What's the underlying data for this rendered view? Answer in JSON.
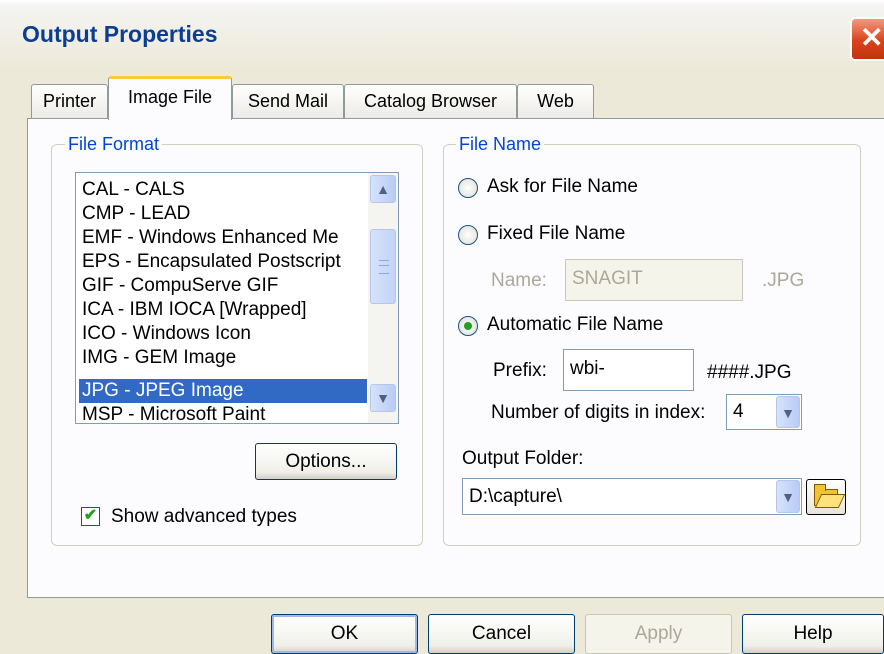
{
  "window": {
    "title": "Output Properties",
    "close_glyph": "✕"
  },
  "tabs": [
    {
      "label": "Printer",
      "active": false
    },
    {
      "label": "Image File",
      "active": true
    },
    {
      "label": "Send Mail",
      "active": false
    },
    {
      "label": "Catalog Browser",
      "active": false
    },
    {
      "label": "Web",
      "active": false
    }
  ],
  "file_format": {
    "legend": "File Format",
    "items": [
      "CAL - CALS",
      "CMP - LEAD",
      "EMF - Windows Enhanced Me",
      "EPS - Encapsulated Postscript",
      "GIF - CompuServe GIF",
      "ICA - IBM IOCA [Wrapped]",
      "ICO - Windows Icon",
      "IMG - GEM Image",
      "JPG - JPEG Image",
      "MSP - Microsoft Paint"
    ],
    "selected": "JPG - JPEG Image",
    "options_button": "Options...",
    "show_advanced_label": "Show advanced types",
    "show_advanced_checked": true,
    "checkmark": "✔",
    "scroll_up_glyph": "▲",
    "scroll_down_glyph": "▼"
  },
  "file_name": {
    "legend": "File Name",
    "ask_label": "Ask for File Name",
    "fixed_label": "Fixed File Name",
    "name_label": "Name:",
    "name_value": "SNAGIT",
    "name_ext": ".JPG",
    "automatic_label": "Automatic File Name",
    "selected_option": "Automatic File Name",
    "prefix_label": "Prefix:",
    "prefix_value": "wbi-",
    "prefix_suffix": "####.JPG",
    "digits_label": "Number of digits in index:",
    "digits_value": "4",
    "output_folder_label": "Output Folder:",
    "output_folder_value": "D:\\capture\\",
    "dropdown_glyph": "▼"
  },
  "buttons": {
    "ok": "OK",
    "cancel": "Cancel",
    "apply": "Apply",
    "help": "Help"
  },
  "colors": {
    "dialog_bg": "#ECE9D8",
    "selection": "#316AC5",
    "group_legend": "#0046D5",
    "title_text": "#0B3D91",
    "close_button": "#D8431C",
    "check_green": "#21A121"
  }
}
